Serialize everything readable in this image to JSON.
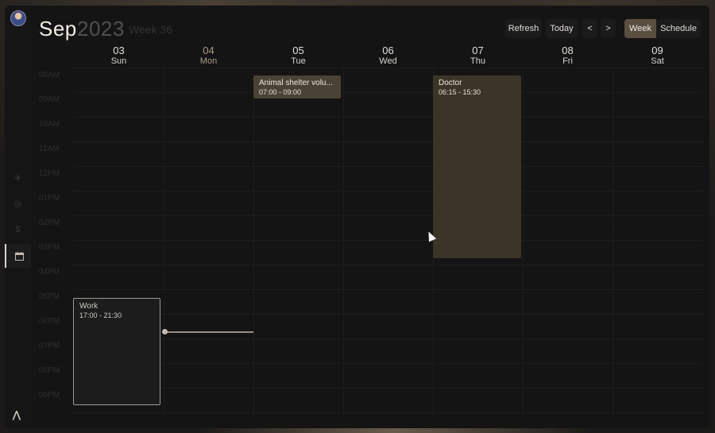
{
  "header": {
    "month": "Sep",
    "year": "2023",
    "week": "Week 36"
  },
  "toolbar": {
    "refresh": "Refresh",
    "today": "Today",
    "prev": "<",
    "next": ">",
    "week": "Week",
    "schedule": "Schedule"
  },
  "days": [
    {
      "num": "03",
      "name": "Sun"
    },
    {
      "num": "04",
      "name": "Mon",
      "today": true
    },
    {
      "num": "05",
      "name": "Tue"
    },
    {
      "num": "06",
      "name": "Wed"
    },
    {
      "num": "07",
      "name": "Thu"
    },
    {
      "num": "08",
      "name": "Fri"
    },
    {
      "num": "09",
      "name": "Sat"
    }
  ],
  "times": [
    "08AM",
    "09AM",
    "10AM",
    "11AM",
    "12PM",
    "01PM",
    "02PM",
    "03PM",
    "04PM",
    "05PM",
    "06PM",
    "07PM",
    "08PM",
    "09PM"
  ],
  "events": {
    "animal": {
      "title": "Animal shelter volu...",
      "time": "07:00 - 09:00"
    },
    "doctor": {
      "title": "Doctor",
      "time": "06:15 - 15:30"
    },
    "work": {
      "title": "Work",
      "time": "17:00 - 21:30"
    }
  },
  "sidebar": {
    "icons": [
      "avatar",
      "rocket-icon",
      "circle-icon",
      "dollar-icon",
      "calendar-icon"
    ],
    "logo": "⋀"
  },
  "colors": {
    "accent": "#5a4e40",
    "event": "#4a4234",
    "doctor": "#3b3528"
  }
}
